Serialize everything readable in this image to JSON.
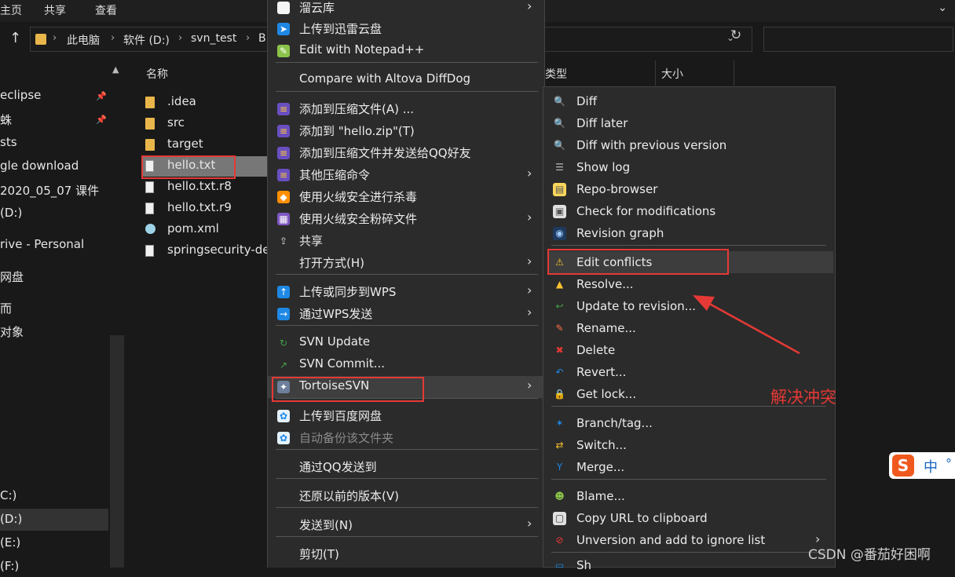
{
  "ribbon": {
    "tabs": [
      "主页",
      "共享",
      "查看"
    ]
  },
  "address": {
    "crumbs": [
      "此电脑",
      "软件 (D:)",
      "svn_test",
      "B"
    ]
  },
  "nav": {
    "items": [
      {
        "label": "eclipse",
        "pin": true
      },
      {
        "label": "蛛",
        "pin": true
      },
      {
        "label": "sts",
        "pin": false
      },
      {
        "label": "gle download",
        "pin": false
      },
      {
        "label": "2020_05_07 课件",
        "pin": false
      },
      {
        "label": "(D:)",
        "pin": false
      },
      {
        "label": "rive - Personal",
        "pin": false
      },
      {
        "label": "网盘",
        "pin": false
      },
      {
        "label": "而",
        "pin": false
      },
      {
        "label": "对象",
        "pin": false
      },
      {
        "label": "C:)",
        "pin": false
      },
      {
        "label": "(D:)",
        "pin": false
      },
      {
        "label": "(E:)",
        "pin": false
      },
      {
        "label": "(F:)",
        "pin": false
      }
    ]
  },
  "files": {
    "column_name": "名称",
    "items": [
      {
        "name": ".idea",
        "type": "folder"
      },
      {
        "name": "src",
        "type": "folder"
      },
      {
        "name": "target",
        "type": "folder"
      },
      {
        "name": "hello.txt",
        "type": "doc"
      },
      {
        "name": "hello.txt.r8",
        "type": "doc"
      },
      {
        "name": "hello.txt.r9",
        "type": "doc"
      },
      {
        "name": "pom.xml",
        "type": "xml"
      },
      {
        "name": "springsecurity-de",
        "type": "doc"
      }
    ]
  },
  "columns": {
    "type": "类型",
    "size": "大小"
  },
  "context_menu": {
    "items": [
      {
        "label": "溜云库",
        "icon": "doc-icon",
        "arrow": true
      },
      {
        "label": "上传到迅雷云盘",
        "icon": "thunder-icon",
        "arrow": false
      },
      {
        "label": "Edit with Notepad++",
        "icon": "notepad-icon",
        "arrow": false
      },
      {
        "label": "Compare with Altova DiffDog",
        "icon": "",
        "arrow": false
      },
      {
        "label": "添加到压缩文件(A) ...",
        "icon": "archive-icon",
        "arrow": false
      },
      {
        "label": "添加到 \"hello.zip\"(T)",
        "icon": "archive-icon",
        "arrow": false
      },
      {
        "label": "添加到压缩文件并发送给QQ好友",
        "icon": "archive-icon",
        "arrow": false
      },
      {
        "label": "其他压缩命令",
        "icon": "archive-icon",
        "arrow": true
      },
      {
        "label": "使用火绒安全进行杀毒",
        "icon": "shield-icon",
        "arrow": false
      },
      {
        "label": "使用火绒安全粉碎文件",
        "icon": "shredder-icon",
        "arrow": true
      },
      {
        "label": "共享",
        "icon": "share-icon",
        "arrow": false
      },
      {
        "label": "打开方式(H)",
        "icon": "",
        "arrow": true
      },
      {
        "label": "上传或同步到WPS",
        "icon": "cloud-upload-icon",
        "arrow": true
      },
      {
        "label": "通过WPS发送",
        "icon": "send-icon",
        "arrow": true
      },
      {
        "label": "SVN Update",
        "icon": "svn-update-icon",
        "arrow": false
      },
      {
        "label": "SVN Commit...",
        "icon": "svn-commit-icon",
        "arrow": false
      },
      {
        "label": "TortoiseSVN",
        "icon": "tortoise-icon",
        "arrow": true
      },
      {
        "label": "上传到百度网盘",
        "icon": "baidu-icon",
        "arrow": false
      },
      {
        "label": "自动备份该文件夹",
        "icon": "baidu-icon",
        "arrow": false,
        "disabled": true
      },
      {
        "label": "通过QQ发送到",
        "icon": "",
        "arrow": false
      },
      {
        "label": "还原以前的版本(V)",
        "icon": "",
        "arrow": false
      },
      {
        "label": "发送到(N)",
        "icon": "",
        "arrow": true
      },
      {
        "label": "剪切(T)",
        "icon": "",
        "arrow": false
      }
    ]
  },
  "svn_submenu": {
    "items": [
      {
        "label": "Diff",
        "icon": "magnifier-icon"
      },
      {
        "label": "Diff later",
        "icon": "magnifier-icon"
      },
      {
        "label": "Diff with previous version",
        "icon": "magnifier-icon"
      },
      {
        "label": "Show log",
        "icon": "log-icon"
      },
      {
        "label": "Repo-browser",
        "icon": "repo-icon"
      },
      {
        "label": "Check for modifications",
        "icon": "check-icon"
      },
      {
        "label": "Revision graph",
        "icon": "graph-icon"
      },
      {
        "label": "Edit conflicts",
        "icon": "warning-icon"
      },
      {
        "label": "Resolve...",
        "icon": "resolve-icon"
      },
      {
        "label": "Update to revision...",
        "icon": "update-icon"
      },
      {
        "label": "Rename...",
        "icon": "pencil-icon"
      },
      {
        "label": "Delete",
        "icon": "delete-icon"
      },
      {
        "label": "Revert...",
        "icon": "revert-icon"
      },
      {
        "label": "Get lock...",
        "icon": "lock-icon"
      },
      {
        "label": "Branch/tag...",
        "icon": "branch-icon"
      },
      {
        "label": "Switch...",
        "icon": "switch-icon"
      },
      {
        "label": "Merge...",
        "icon": "merge-icon"
      },
      {
        "label": "Blame...",
        "icon": "blame-icon"
      },
      {
        "label": "Copy URL to clipboard",
        "icon": "clipboard-icon"
      },
      {
        "label": "Unversion and add to ignore list",
        "icon": "ignore-icon",
        "arrow": true
      },
      {
        "label": "Sh",
        "icon": "shelve-icon"
      }
    ]
  },
  "annotation": {
    "text": "解决冲突"
  },
  "watermark": "CSDN @番茄好困啊",
  "ime": {
    "logo": "S",
    "mode": "中",
    "extra": "°"
  }
}
